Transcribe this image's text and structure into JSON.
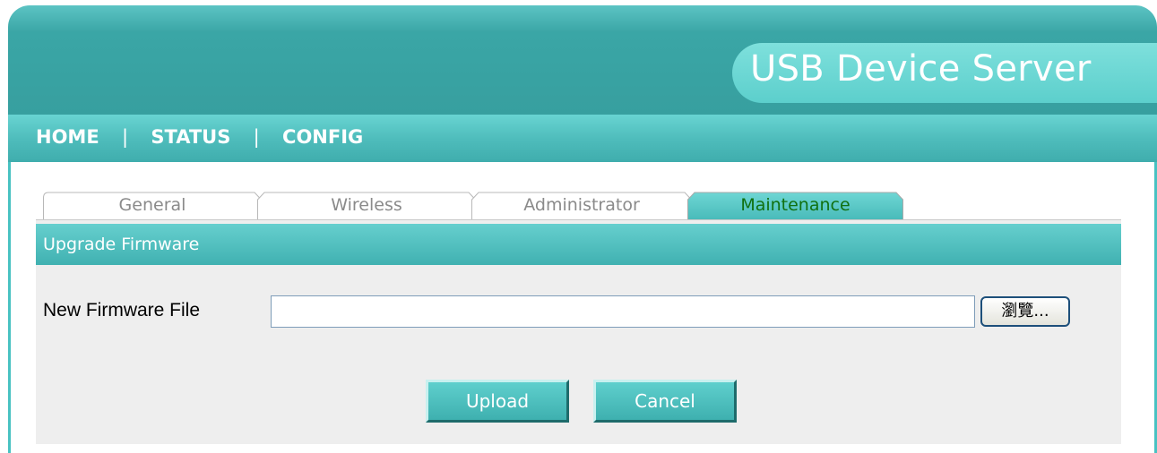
{
  "app": {
    "title": "USB Device Server"
  },
  "nav": {
    "items": [
      {
        "label": "HOME"
      },
      {
        "label": "STATUS"
      },
      {
        "label": "CONFIG"
      }
    ],
    "separator": "|"
  },
  "tabs": [
    {
      "label": "General",
      "active": false
    },
    {
      "label": "Wireless",
      "active": false
    },
    {
      "label": "Administrator",
      "active": false
    },
    {
      "label": "Maintenance",
      "active": true
    }
  ],
  "section": {
    "title": "Upgrade Firmware"
  },
  "form": {
    "field_label": "New Firmware File",
    "file_value": "",
    "browse_label": "瀏覽..."
  },
  "actions": {
    "upload_label": "Upload",
    "cancel_label": "Cancel"
  },
  "colors": {
    "header_teal": "#379f9f",
    "accent_light": "#7ee0dc",
    "active_tab_text": "#107010",
    "panel_bg": "#eeeeee"
  }
}
